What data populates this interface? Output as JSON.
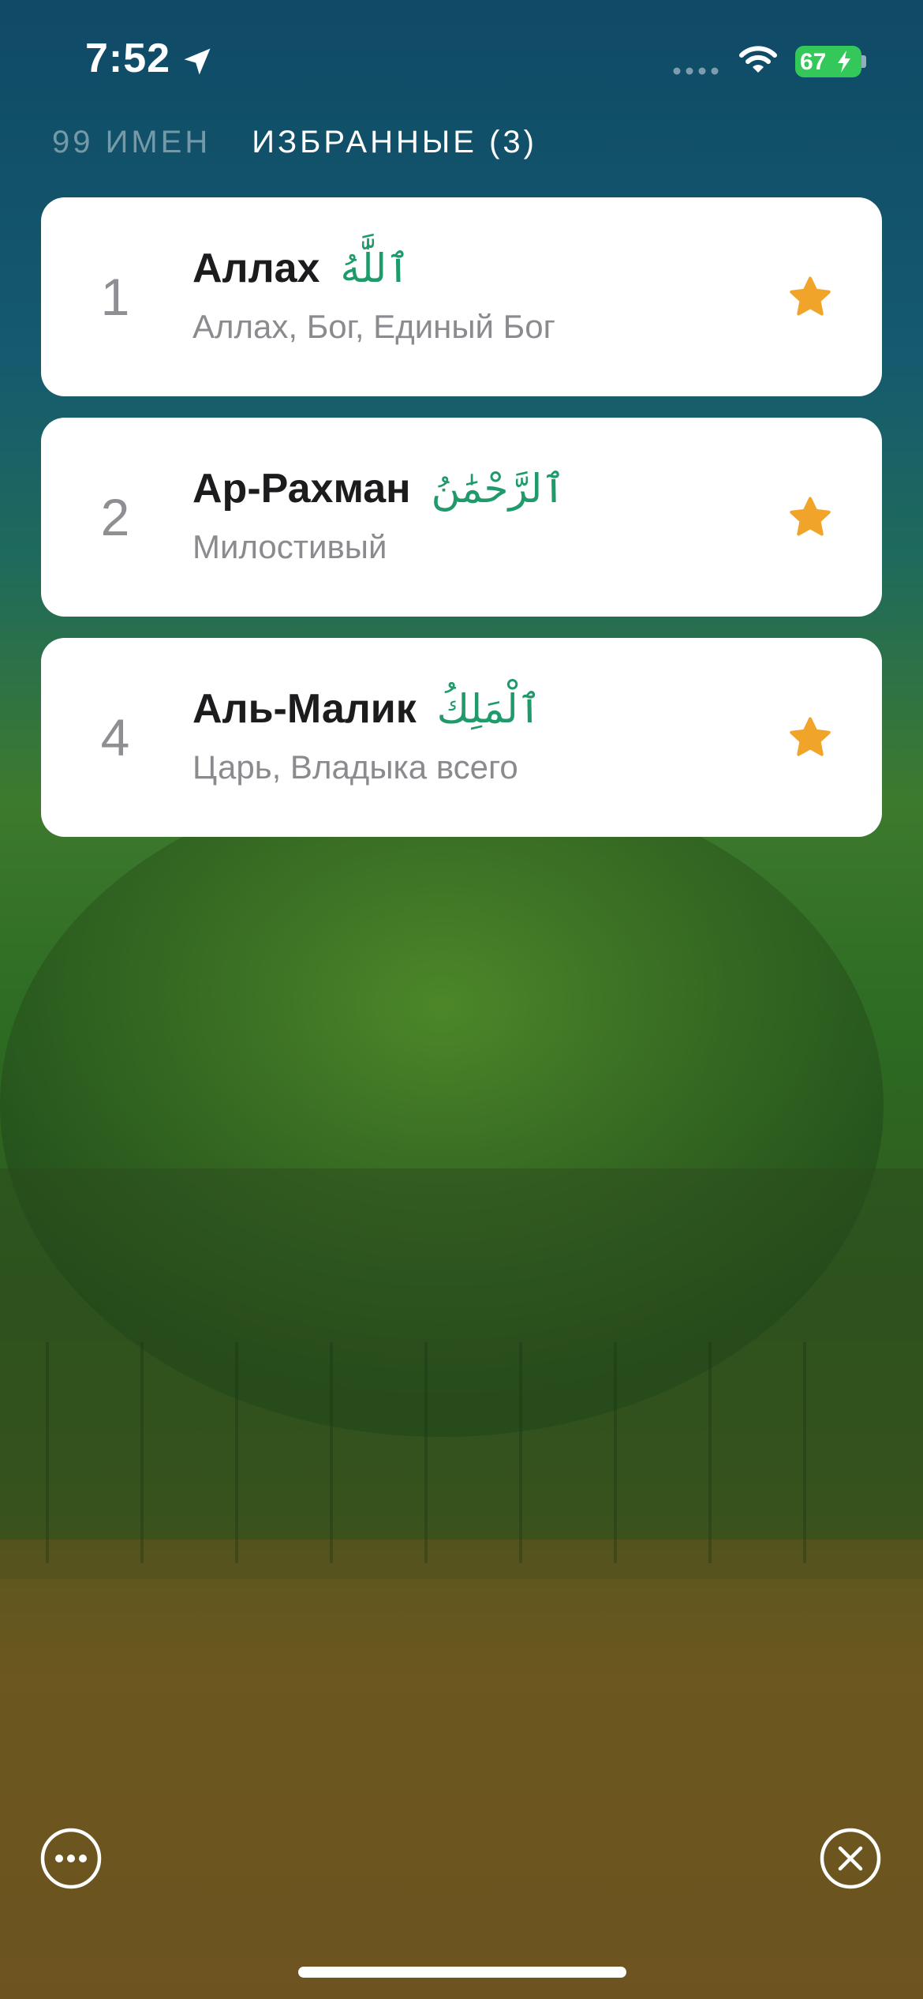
{
  "status_bar": {
    "time": "7:52",
    "battery_level": "67",
    "icons": [
      "location-arrow-icon",
      "cellular-signal-icon",
      "wifi-icon",
      "battery-charging-icon"
    ]
  },
  "tabs": [
    {
      "label": "99 ИМЕН",
      "active": false
    },
    {
      "label": "ИЗБРАННЫЕ (3)",
      "active": true
    }
  ],
  "favorites": [
    {
      "number": "1",
      "name": "Аллах",
      "arabic": "ٱللَّٰهُ",
      "meaning": "Аллах, Бог, Единый Бог",
      "favorite": true
    },
    {
      "number": "2",
      "name": "Ар-Рахман",
      "arabic": "ٱلرَّحْمَٰنُ",
      "meaning": "Милостивый",
      "favorite": true
    },
    {
      "number": "4",
      "name": "Аль-Малик",
      "arabic": "ٱلْمَلِكُ",
      "meaning": "Царь, Владыка всего",
      "favorite": true
    }
  ],
  "colors": {
    "star": "#f0a52a",
    "arabic_text": "#1f9a6a",
    "card_bg": "#ffffff",
    "battery": "#34c759"
  },
  "bottom_controls": [
    "more-options-icon",
    "close-icon"
  ]
}
